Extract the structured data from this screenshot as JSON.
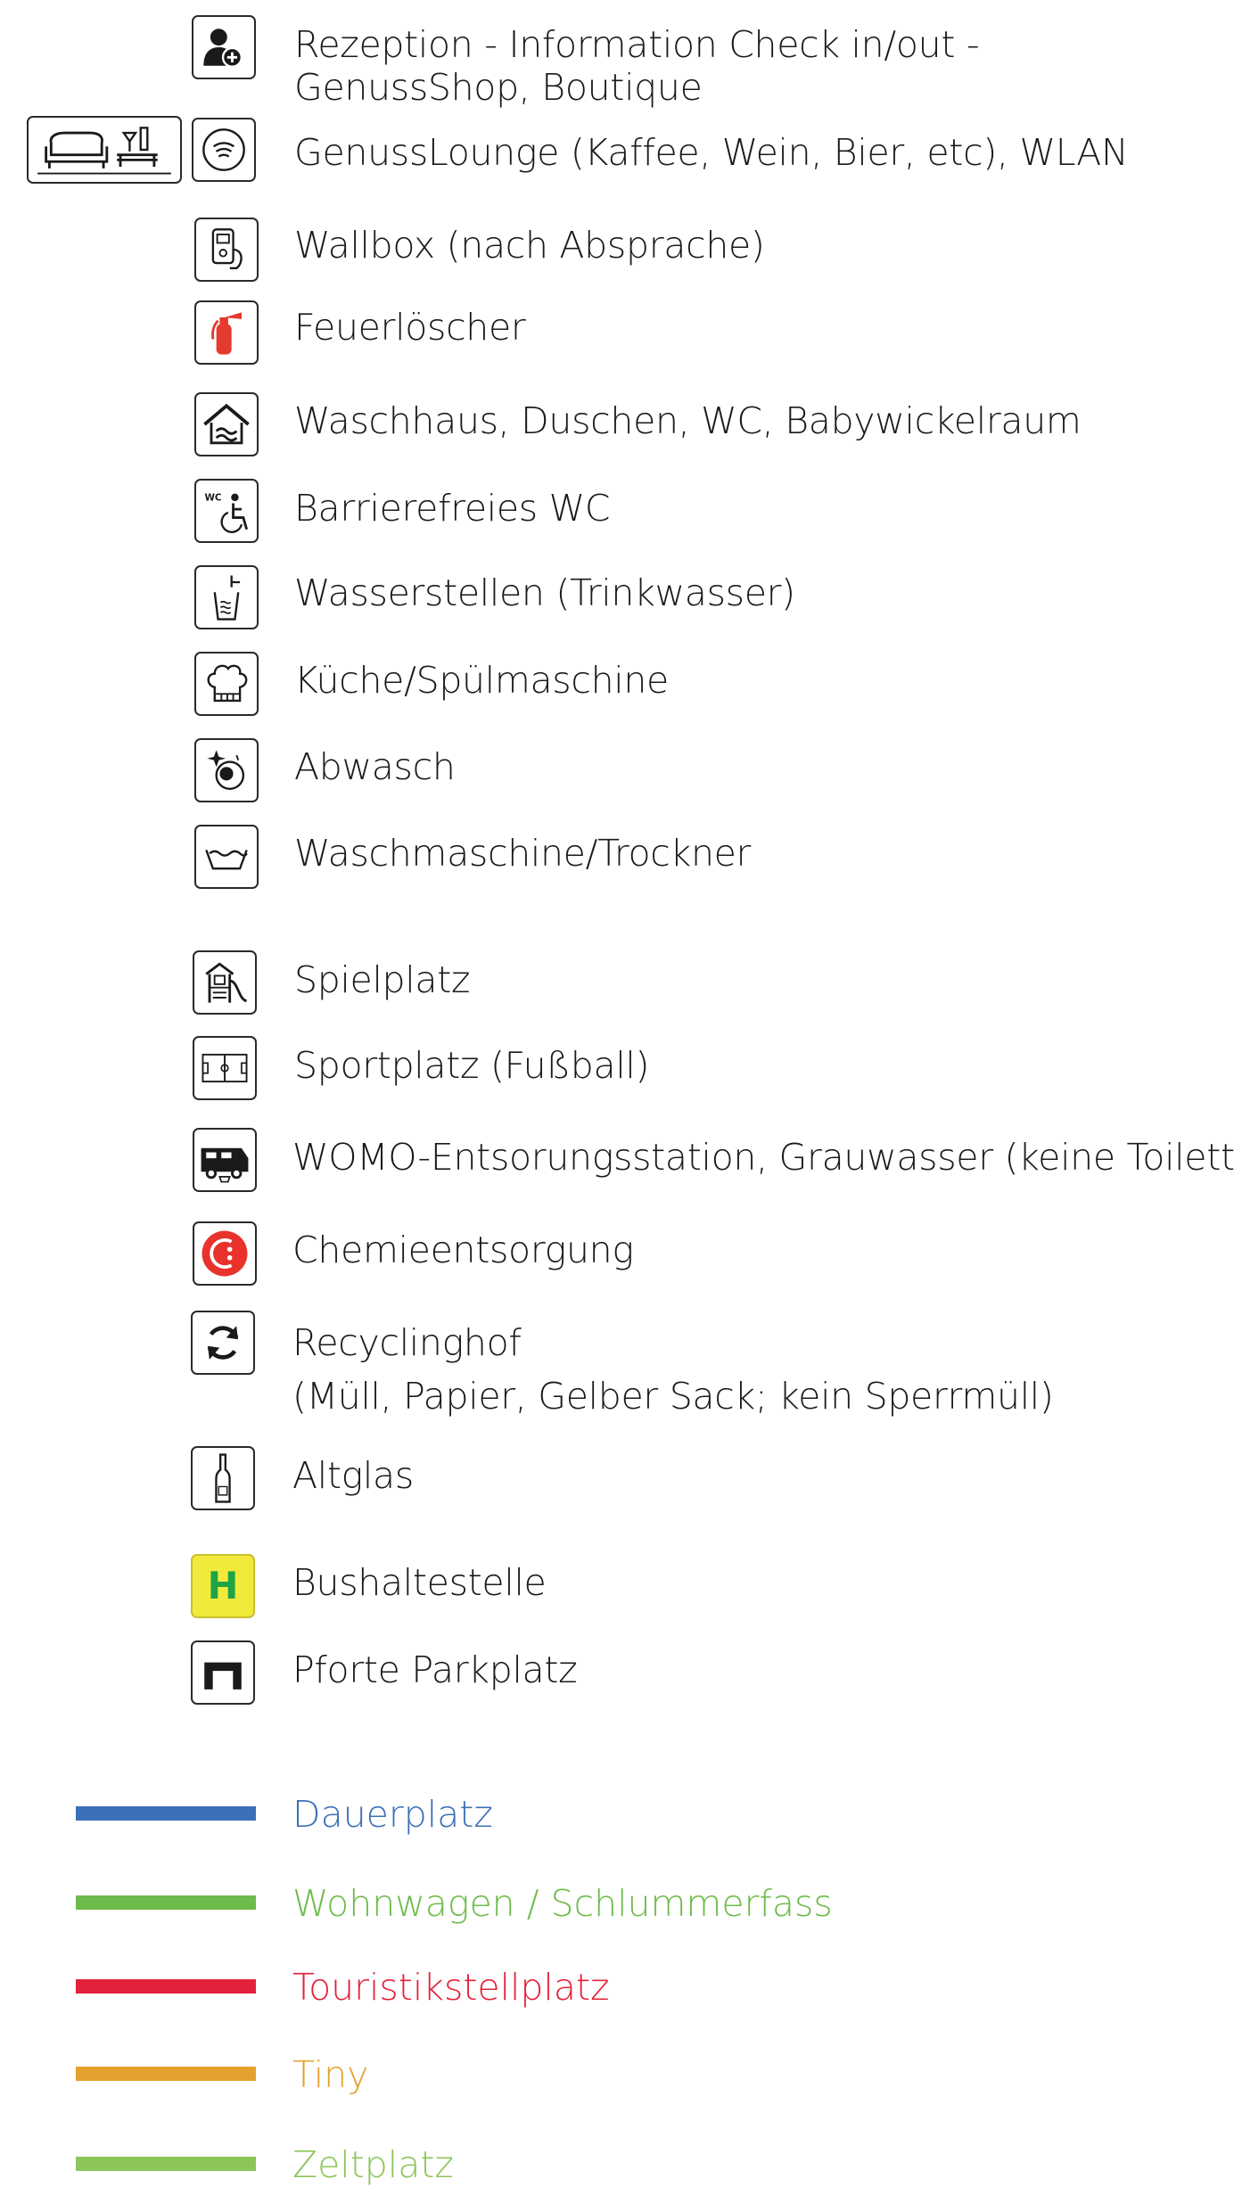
{
  "legend_items": [
    {
      "label": "Rezeption - Information Check in/out -\nGenussShop, Boutique",
      "icon": "reception-person-plus-icon"
    },
    {
      "label": "GenussLounge (Kaffee, Wein, Bier, etc), WLAN",
      "icon": "wifi-icon"
    },
    {
      "label": "Wallbox (nach Absprache)",
      "icon": "ev-charger-icon"
    },
    {
      "label": "Feuerlöscher",
      "icon": "fire-extinguisher-icon"
    },
    {
      "label": "Waschhaus, Duschen, WC, Babywickelraum",
      "icon": "washhouse-icon"
    },
    {
      "label": "Barrierefreies WC",
      "icon": "accessible-wc-icon"
    },
    {
      "label": "Wasserstellen (Trinkwasser)",
      "icon": "water-tap-icon"
    },
    {
      "label": "Küche/Spülmaschine",
      "icon": "chef-hat-icon"
    },
    {
      "label": "Abwasch",
      "icon": "dishwashing-icon"
    },
    {
      "label": "Waschmaschine/Trockner",
      "icon": "washing-machine-icon"
    },
    {
      "label": "Spielplatz",
      "icon": "playground-icon"
    },
    {
      "label": "Sportplatz (Fußball)",
      "icon": "football-field-icon"
    },
    {
      "label": "WOMO-Entsorungsstation, Grauwasser (keine Toilette)",
      "icon": "motorhome-disposal-icon"
    },
    {
      "label": "Chemieentsorgung",
      "icon": "chemical-disposal-icon"
    },
    {
      "label": "Recyclinghof\n(Müll, Papier, Gelber Sack; kein Sperrmüll)",
      "icon": "recycling-icon"
    },
    {
      "label": "Altglas",
      "icon": "glass-bottle-icon"
    },
    {
      "label": "Bushaltestelle",
      "icon": "bus-stop-icon",
      "icon_text": "H"
    },
    {
      "label": "Pforte Parkplatz",
      "icon": "gate-icon"
    }
  ],
  "lounge_extra_icon": "lounge-sofa-bar-icon",
  "pitch_types": [
    {
      "label": "Dauerplatz",
      "color": "#3c70b8"
    },
    {
      "label": "Wohnwagen / Schlummerfass",
      "color": "#6dbb4a"
    },
    {
      "label": "Touristikstellplatz",
      "color": "#e2213a"
    },
    {
      "label": "Tiny",
      "color": "#e5a12f"
    },
    {
      "label": "Zeltplatz",
      "color": "#8cc65a"
    }
  ],
  "colors": {
    "fire_red": "#e53a2e",
    "chem_red": "#e8322b",
    "bus_yellow": "#f2ea3b",
    "bus_green": "#1fa347"
  }
}
